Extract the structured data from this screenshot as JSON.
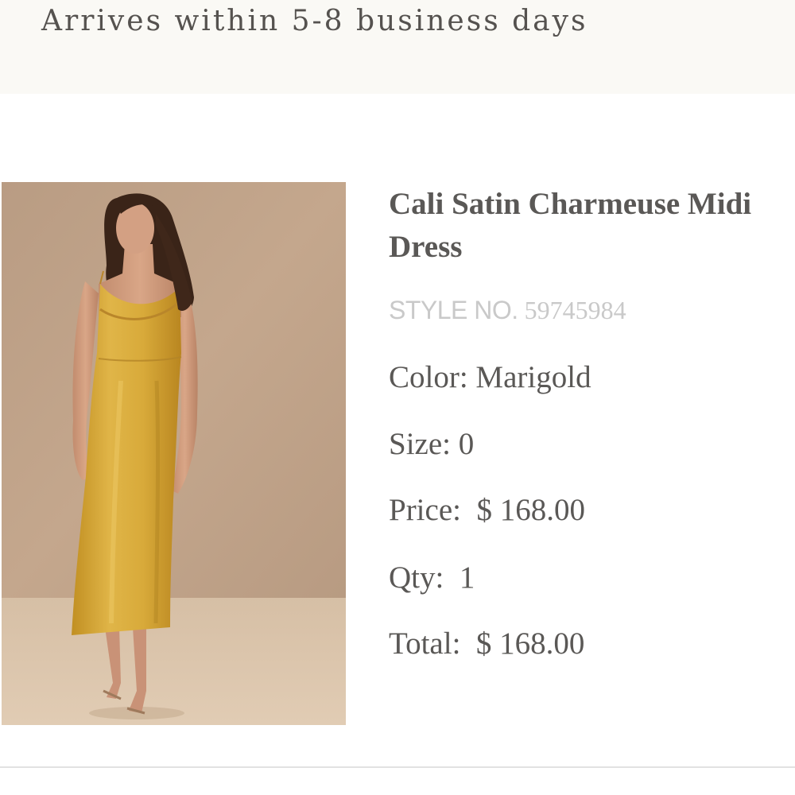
{
  "shipping": {
    "message": "Arrives within 5-8 business days"
  },
  "product": {
    "name": "Cali Satin Charmeuse Midi Dress",
    "style_label": "STYLE NO.",
    "style_number": "59745984",
    "color_label": "Color:",
    "color_value": "Marigold",
    "size_label": "Size:",
    "size_value": "0",
    "price_label": "Price:",
    "price_value": "$ 168.00",
    "qty_label": "Qty:",
    "qty_value": "1",
    "total_label": "Total:",
    "total_value": "$ 168.00"
  },
  "colors": {
    "text": "#5a5856",
    "muted": "#c9c9c9",
    "banner_bg": "#faf9f5",
    "dress": "#d4a534",
    "backdrop": "#c2a58b",
    "floor": "#ddc7ae"
  }
}
